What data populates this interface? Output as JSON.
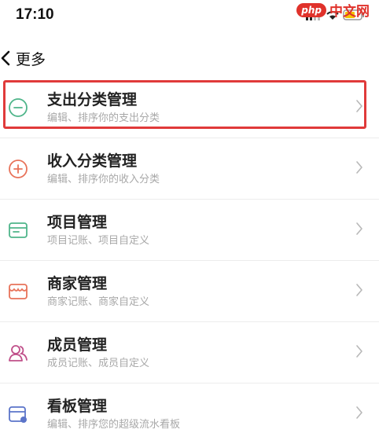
{
  "status": {
    "time": "17:10"
  },
  "watermark": {
    "logo": "php",
    "text": "中文网"
  },
  "nav": {
    "title": "更多"
  },
  "menu": [
    {
      "title": "支出分类管理",
      "subtitle": "编辑、排序你的支出分类",
      "icon": "minus-circle-icon",
      "color": "#4fb58a"
    },
    {
      "title": "收入分类管理",
      "subtitle": "编辑、排序你的收入分类",
      "icon": "plus-circle-icon",
      "color": "#e8735a"
    },
    {
      "title": "项目管理",
      "subtitle": "项目记账、项目自定义",
      "icon": "folder-icon",
      "color": "#4fb58a"
    },
    {
      "title": "商家管理",
      "subtitle": "商家记账、商家自定义",
      "icon": "shop-icon",
      "color": "#e8735a"
    },
    {
      "title": "成员管理",
      "subtitle": "成员记账、成员自定义",
      "icon": "members-icon",
      "color": "#c0508a"
    },
    {
      "title": "看板管理",
      "subtitle": "编辑、排序您的超级流水看板",
      "icon": "board-icon",
      "color": "#5b74c9"
    }
  ],
  "colors": {
    "highlight": "#e03a3a",
    "divider": "#ececec"
  }
}
